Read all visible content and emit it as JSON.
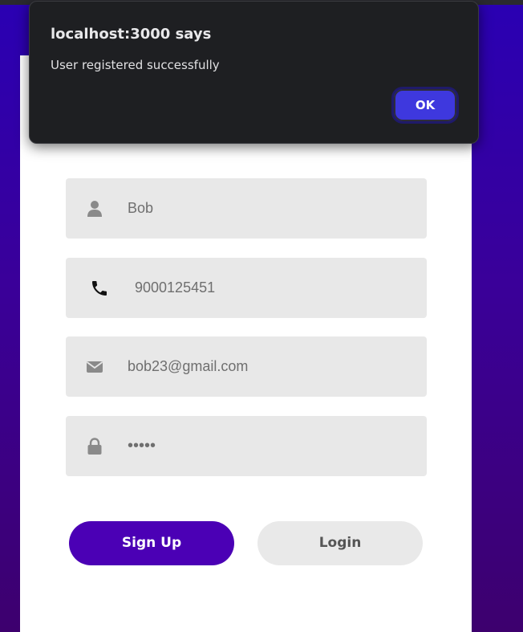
{
  "form": {
    "fields": [
      {
        "icon": "user-icon",
        "value": "Bob"
      },
      {
        "icon": "phone-icon",
        "value": "9000125451"
      },
      {
        "icon": "email-icon",
        "value": "bob23@gmail.com"
      },
      {
        "icon": "lock-icon",
        "value": "•••••"
      }
    ],
    "signup_label": "Sign Up",
    "login_label": "Login"
  },
  "dialog": {
    "title": "localhost:3000 says",
    "message": "User registered successfully",
    "ok_label": "OK"
  },
  "colors": {
    "accent": "#4b00b5",
    "dialog_button": "#3e38de",
    "field_bg": "#e8e8e8"
  }
}
